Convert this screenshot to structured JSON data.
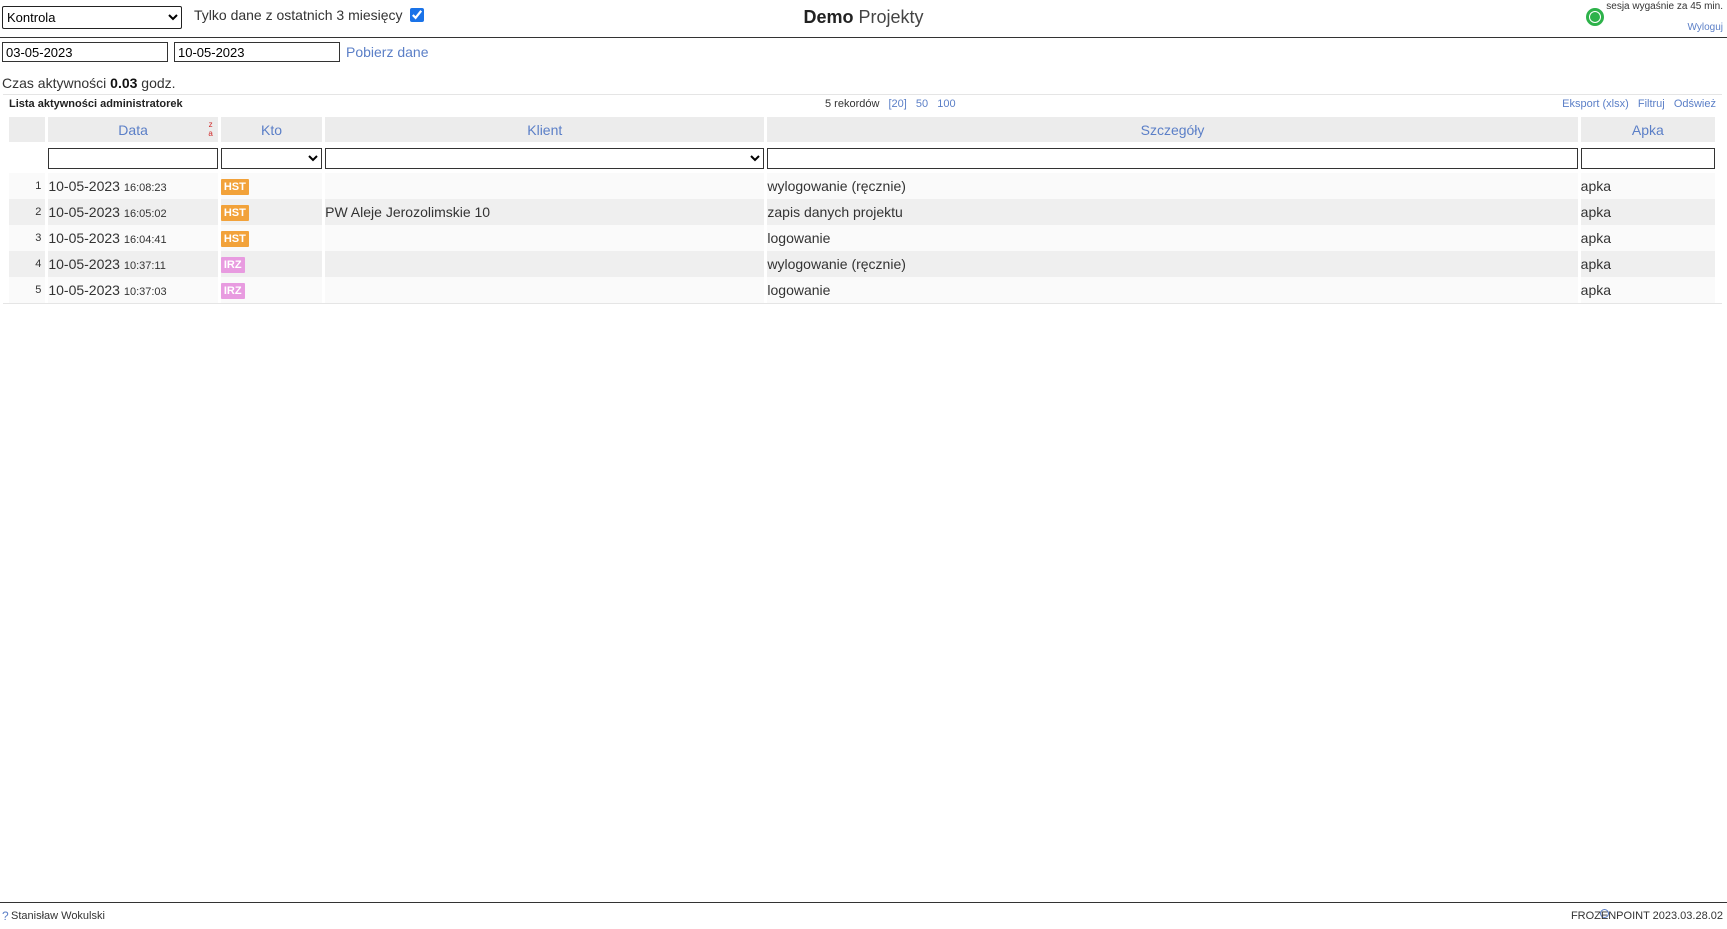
{
  "header": {
    "module_select": {
      "selected": "Kontrola"
    },
    "only_recent_label": "Tylko dane z ostatnich 3 miesięcy",
    "only_recent_checked": true,
    "title_brand": "Demo",
    "title_app": "Projekty",
    "session_text": "sesja wygaśnie za 45 min.",
    "logout_label": "Wyloguj"
  },
  "filters": {
    "date_from": "03-05-2023",
    "date_to": "10-05-2023",
    "fetch_label": "Pobierz dane"
  },
  "activity": {
    "label": "Czas aktywności",
    "value": "0.03",
    "unit": "godz."
  },
  "list": {
    "title": "Lista aktywności administratorek",
    "records_label": "5 rekordów",
    "page_sizes": [
      "[20]",
      "50",
      "100"
    ],
    "actions": [
      "Eksport (xlsx)",
      "Filtruj",
      "Odśwież"
    ],
    "sort_icon": "z\na",
    "columns": [
      "Data",
      "Kto",
      "Klient",
      "Szczegóły",
      "Apka"
    ],
    "rows": [
      {
        "num": "1",
        "date": "10-05-2023",
        "time": "16:08:23",
        "who": "HST",
        "client": "",
        "details": "wylogowanie (ręcznie)",
        "app": "apka"
      },
      {
        "num": "2",
        "date": "10-05-2023",
        "time": "16:05:02",
        "who": "HST",
        "client": "PW Aleje Jerozolimskie 10",
        "details": "zapis danych projektu",
        "app": "apka"
      },
      {
        "num": "3",
        "date": "10-05-2023",
        "time": "16:04:41",
        "who": "HST",
        "client": "",
        "details": "logowanie",
        "app": "apka"
      },
      {
        "num": "4",
        "date": "10-05-2023",
        "time": "10:37:11",
        "who": "IRZ",
        "client": "",
        "details": "wylogowanie (ręcznie)",
        "app": "apka"
      },
      {
        "num": "5",
        "date": "10-05-2023",
        "time": "10:37:03",
        "who": "IRZ",
        "client": "",
        "details": "logowanie",
        "app": "apka"
      }
    ]
  },
  "footer": {
    "help_icon": "?",
    "user": "Stanisław Wokulski",
    "version": "FROZENPOINT 2023.03.28.02"
  },
  "colors": {
    "link": "#5b7fc7",
    "status_online": "#2db24a",
    "badge_hst": "#f2a23a",
    "badge_irz": "#e89be0"
  }
}
